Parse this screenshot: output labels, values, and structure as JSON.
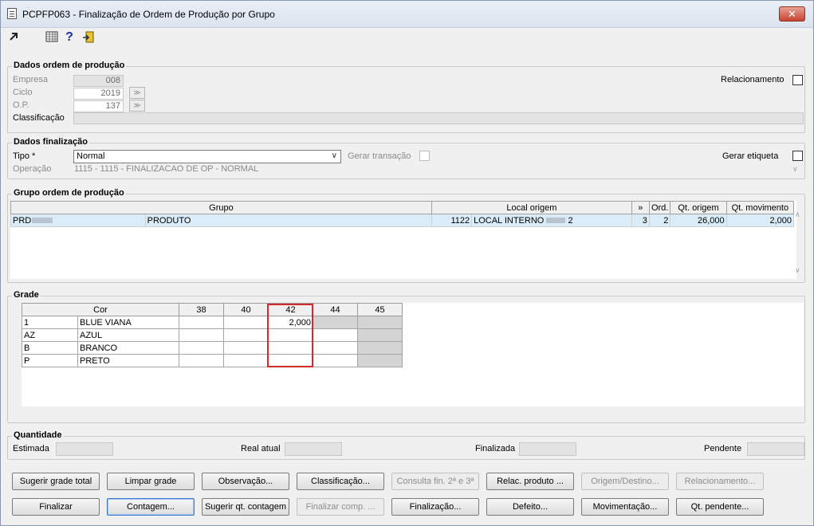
{
  "window": {
    "title": "PCPFP063 - Finalização de Ordem de Produção por Grupo",
    "close": "✕"
  },
  "toolbar": {
    "icons": [
      "arrow-cursor-icon",
      "calendar-grid-icon",
      "help-icon",
      "exit-door-icon"
    ],
    "help_glyph": "?"
  },
  "dados_ordem": {
    "legend": "Dados ordem de produção",
    "empresa_label": "Empresa",
    "empresa_value": "008",
    "ciclo_label": "Ciclo",
    "ciclo_value": "2019",
    "op_label": "O.P.",
    "op_value": "137",
    "classificacao_label": "Classificação",
    "classificacao_value": "",
    "relacionamento_label": "Relacionamento",
    "lookup_glyph": "≫"
  },
  "dados_finalizacao": {
    "legend": "Dados finalização",
    "tipo_label": "Tipo *",
    "tipo_value": "Normal",
    "gerar_transacao_label": "Gerar transação",
    "gerar_etiqueta_label": "Gerar etiqueta",
    "operacao_label": "Operação",
    "operacao_value": "1115 - 1115 - FINALIZACAO DE OP - NORMAL"
  },
  "grupo_ordem": {
    "legend": "Grupo ordem de produção",
    "columns": [
      "Grupo",
      "Local origem",
      "»",
      "Ord.",
      "Qt. origem",
      "Qt. movimento"
    ],
    "rows": [
      {
        "grupo_code": "PRD",
        "grupo_name": "PRODUTO",
        "local_code": "1122",
        "local_name": "LOCAL INTERNO",
        "local_suffix": "2",
        "seq": "3",
        "ord": "2",
        "qt_origem": "26,000",
        "qt_movimento": "2,000"
      }
    ]
  },
  "grade": {
    "legend": "Grade",
    "cor_header": "Cor",
    "sizes": [
      "38",
      "40",
      "42",
      "44",
      "45"
    ],
    "rows": [
      {
        "code": "1",
        "name": "BLUE VIANA",
        "values": [
          "",
          "",
          "2,000",
          "",
          ""
        ]
      },
      {
        "code": "AZ",
        "name": "AZUL",
        "values": [
          "",
          "",
          "",
          "",
          ""
        ]
      },
      {
        "code": "B",
        "name": "BRANCO",
        "values": [
          "",
          "",
          "",
          "",
          ""
        ]
      },
      {
        "code": "P",
        "name": "PRETO",
        "values": [
          "",
          "",
          "",
          "",
          ""
        ]
      }
    ]
  },
  "quantidade": {
    "legend": "Quantidade",
    "estimada_label": "Estimada",
    "real_label": "Real atual",
    "finalizada_label": "Finalizada",
    "pendente_label": "Pendente"
  },
  "buttons_row1": [
    {
      "label": "Sugerir grade total",
      "enabled": true
    },
    {
      "label": "Limpar grade",
      "enabled": true
    },
    {
      "label": "Observação...",
      "enabled": true
    },
    {
      "label": "Classificação...",
      "enabled": true
    },
    {
      "label": "Consulta fin. 2ª e 3ª",
      "enabled": false
    },
    {
      "label": "Relac. produto ...",
      "enabled": true
    },
    {
      "label": "Origem/Destino...",
      "enabled": false
    },
    {
      "label": "Relacionamento...",
      "enabled": false
    }
  ],
  "buttons_row2": [
    {
      "label": "Finalizar",
      "enabled": true
    },
    {
      "label": "Contagem...",
      "enabled": true
    },
    {
      "label": "Sugerir qt. contagem",
      "enabled": true
    },
    {
      "label": "Finalizar comp. ...",
      "enabled": false
    },
    {
      "label": "Finalização...",
      "enabled": true
    },
    {
      "label": "Defeito...",
      "enabled": true
    },
    {
      "label": "Movimentação...",
      "enabled": true
    },
    {
      "label": "Qt. pendente...",
      "enabled": true
    }
  ]
}
